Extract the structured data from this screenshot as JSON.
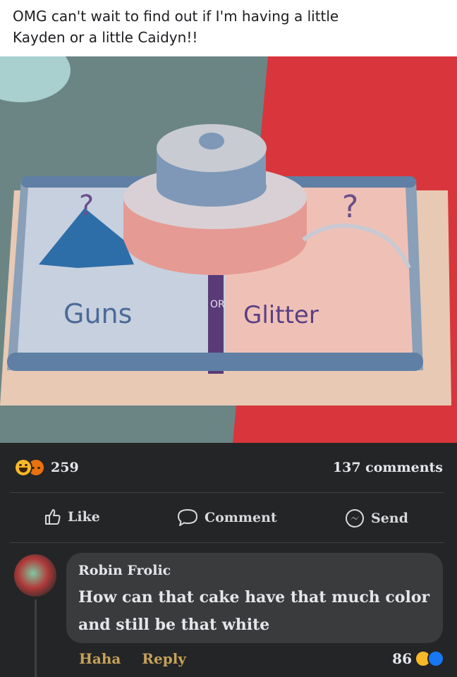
{
  "post": {
    "text_line1": "OMG can't wait to find out if I'm having a little",
    "text_line2": "Kayden or a little Caidyn!!"
  },
  "photo": {
    "cake_left_text": "Guns",
    "cake_center_text": "OR",
    "cake_right_text": "Glitter",
    "colors": {
      "blue": "#6f8fb0",
      "pink": "#e9a3a0",
      "tablecloth_left": "#6b8585",
      "tablecloth_right": "#d8363c"
    }
  },
  "stats": {
    "reaction_count": "259",
    "comments_count": "137 comments",
    "reaction_icons": [
      "haha-icon",
      "angry-icon"
    ]
  },
  "actions": {
    "like": "Like",
    "comment": "Comment",
    "send": "Send"
  },
  "comment": {
    "author": "Robin Frolic",
    "text": "How can that cake have that much color and still be that white",
    "haha": "Haha",
    "reply": "Reply",
    "reaction_count": "86",
    "reaction_icons": [
      "haha-icon",
      "like-icon"
    ]
  }
}
